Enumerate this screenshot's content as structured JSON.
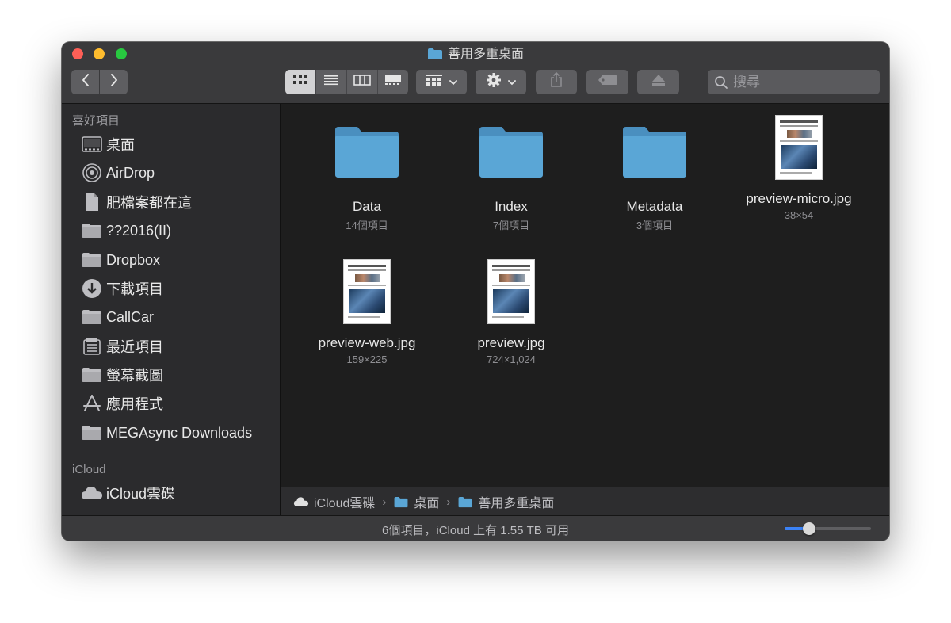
{
  "window": {
    "title": "善用多重桌面"
  },
  "toolbar": {
    "back_icon": "chevron-left-icon",
    "forward_icon": "chevron-right-icon",
    "view_modes": [
      "icon-view",
      "list-view",
      "column-view",
      "gallery-view"
    ],
    "active_view": "icon-view",
    "search_placeholder": "搜尋"
  },
  "sidebar": {
    "favorites_header": "喜好項目",
    "favorites": [
      {
        "label": "桌面",
        "icon": "desktop-icon"
      },
      {
        "label": "AirDrop",
        "icon": "airdrop-icon"
      },
      {
        "label": "肥檔案都在這",
        "icon": "document-icon"
      },
      {
        "label": "??2016(II)",
        "icon": "folder-icon"
      },
      {
        "label": "Dropbox",
        "icon": "folder-icon"
      },
      {
        "label": "下載項目",
        "icon": "download-icon"
      },
      {
        "label": "CallCar",
        "icon": "folder-icon"
      },
      {
        "label": "最近項目",
        "icon": "recents-icon"
      },
      {
        "label": "螢幕截圖",
        "icon": "folder-icon"
      },
      {
        "label": "應用程式",
        "icon": "applications-icon"
      },
      {
        "label": "MEGAsync Downloads",
        "icon": "folder-icon"
      }
    ],
    "icloud_header": "iCloud",
    "icloud": [
      {
        "label": "iCloud雲碟",
        "icon": "cloud-icon"
      }
    ]
  },
  "files": [
    {
      "name": "Data",
      "sub": "14個項目",
      "kind": "folder"
    },
    {
      "name": "Index",
      "sub": "7個項目",
      "kind": "folder"
    },
    {
      "name": "Metadata",
      "sub": "3個項目",
      "kind": "folder"
    },
    {
      "name": "preview-micro.jpg",
      "sub": "38×54",
      "kind": "image"
    },
    {
      "name": "preview-web.jpg",
      "sub": "159×225",
      "kind": "image"
    },
    {
      "name": "preview.jpg",
      "sub": "724×1,024",
      "kind": "image"
    }
  ],
  "pathbar": [
    {
      "label": "iCloud雲碟",
      "icon": "cloud-icon"
    },
    {
      "label": "桌面",
      "icon": "folder-icon"
    },
    {
      "label": "善用多重桌面",
      "icon": "folder-icon"
    }
  ],
  "statusbar": {
    "text": "6個項目，iCloud 上有 1.55 TB 可用",
    "zoom_level": 0.25
  },
  "colors": {
    "folder": "#5aa6d6",
    "accent": "#3b82f6",
    "close": "#fe5f57",
    "minimize": "#febc2e",
    "maximize": "#28c840"
  }
}
